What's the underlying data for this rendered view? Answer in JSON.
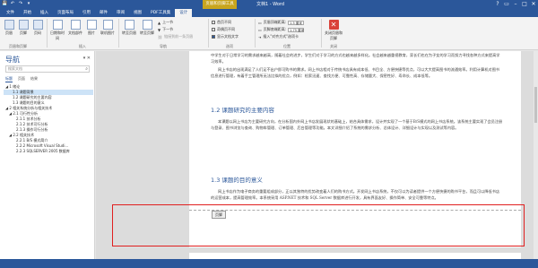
{
  "titlebar": {
    "quick_access": [
      "💾",
      "↶",
      "↷",
      "▾"
    ],
    "context_group": "页眉和页脚工具",
    "title": "文档1 - Word",
    "window_buttons": [
      "?",
      "▭",
      "–",
      "□",
      "✕"
    ]
  },
  "tabs": [
    "文件",
    "开始",
    "插入",
    "页面布局",
    "引用",
    "邮件",
    "审阅",
    "视图",
    "PDF工具集",
    "设计"
  ],
  "ribbon": {
    "hf_group": {
      "header": "页眉",
      "footer": "页脚",
      "page_number": "页码",
      "label": "页眉和页脚"
    },
    "insert_group": {
      "datetime": "日期和时间",
      "docinfo": "文档部件",
      "picture": "图片",
      "online_picture": "联机图片",
      "label": "插入"
    },
    "nav_group": {
      "goto_header": "转至页眉",
      "goto_footer": "转至页脚",
      "prev": "上一节",
      "next": "下一节",
      "link_prev": "链接到前一条页眉",
      "label": "导航"
    },
    "options_group": {
      "first_page": "首页不同",
      "odd_even": "奇偶页不同",
      "show_text": "显示文档文字",
      "label": "选项"
    },
    "position_group": {
      "header_top": "页眉顶端距离:",
      "header_top_val": "1.5 厘米",
      "footer_bottom": "页脚底端距离:",
      "footer_bottom_val": "1.75 厘米",
      "insert_align": "插入\"对齐方式\"选项卡",
      "label": "位置"
    },
    "close_group": {
      "close": "关闭页眉和页脚",
      "label": "关闭"
    }
  },
  "nav_pane": {
    "title": "导航",
    "search_placeholder": "搜索文档",
    "tabs": [
      "标题",
      "页面",
      "结果"
    ],
    "items": [
      {
        "label": "◢ 1 绪论",
        "level": 0
      },
      {
        "label": "1.1 课题背景",
        "level": 1,
        "selected": true
      },
      {
        "label": "1.2 课题研究的主要内容",
        "level": 1
      },
      {
        "label": "1.3 课题的目的意义",
        "level": 1
      },
      {
        "label": "◢ 2 相关系统分析与相关技术",
        "level": 0
      },
      {
        "label": "◢ 2.1 可行性分析",
        "level": 1
      },
      {
        "label": "2.1.1 技术分析",
        "level": 2
      },
      {
        "label": "2.1.2 技术可行分析",
        "level": 2
      },
      {
        "label": "2.1.3 操作可行分析",
        "level": 2
      },
      {
        "label": "◢ 2.2 相关技术",
        "level": 1
      },
      {
        "label": "2.2.1 B/S 模式简介",
        "level": 2
      },
      {
        "label": "2.2.2 Microsoft Visual Studi...",
        "level": 2
      },
      {
        "label": "2.2.3 SQLSERVER 2005 数据库",
        "level": 2
      }
    ]
  },
  "document": {
    "para1": "中学生对于日常学习的需求越来越高，随着社会的进步，学生们对于学习的方式也越来越多样化。社会越来越重视教育，家长们也在为子女的学习而努力寻找各种方式来提高学习效率。",
    "para2": "网上书店的出现满足了人们足不出户即可购书的需求。网上书店相对于传统书店具有成本低、书目全、方便快捷等优点，可以大大提高图书的流通效率。利用计算机对图书信息进行管理，有着手工管理所无法比拟的优点，例如：检索迅速、查找方便、可靠性高、存储量大、保密性好、寿命长、成本低等。",
    "heading2": "1.2 课题研究的主要内容",
    "para3": "本课题以网上书店为主要研究方向，在分析国内外网上书店发展现状的基础上，结合具体需求，设计并实现了一个基于B/S模式的网上书店系统。该系统主要实现了会员注册与登录、图书浏览与查询、购物车管理、订单管理、后台管理等功能。本文详细介绍了系统的需求分析、总体设计、详细设计与实现以及测试等内容。",
    "heading3": "1.3 课题的目的意义",
    "para4": "网上书店作为电子商务的重要组成部分，正以其独特的优势改变着人们的购书方式。开发网上书店系统，不仅可以为读者提供一个方便快捷的购书平台，而且可以降低书店的运营成本，提高管理效率。本系统采用 ASP.NET 技术和 SQL Server 数据库进行开发，具有界面友好、操作简单、安全可靠等特点。",
    "footer_tag": "页脚"
  }
}
